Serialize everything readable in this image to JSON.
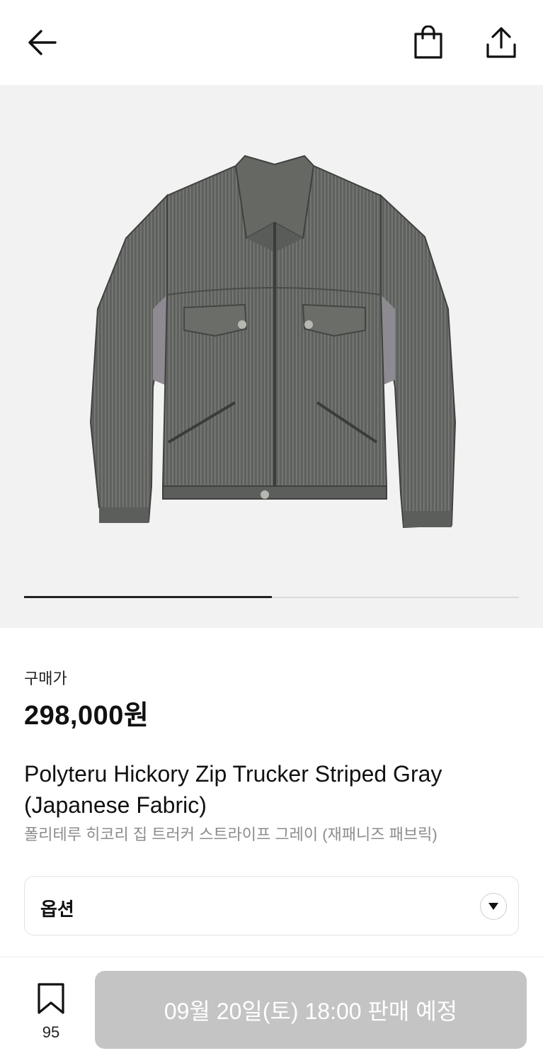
{
  "product": {
    "price_label": "구매가",
    "price": "298,000원",
    "name_en": "Polyteru Hickory Zip Trucker Striped Gray (Japanese Fabric)",
    "name_ko": "폴리테루 히코리 집 트러커 스트라이프 그레이 (재패니즈 패브릭)"
  },
  "gallery": {
    "image_progress": 0.5
  },
  "option": {
    "label": "옵션"
  },
  "bottom_bar": {
    "wish_count": "95",
    "cta_label": "09월 20일(토) 18:00 판매 예정"
  },
  "icons": {
    "back": "arrow-left-icon",
    "bag": "shopping-bag-icon",
    "share": "share-icon",
    "option_arrow": "triangle-down-icon",
    "wish": "bookmark-icon"
  }
}
